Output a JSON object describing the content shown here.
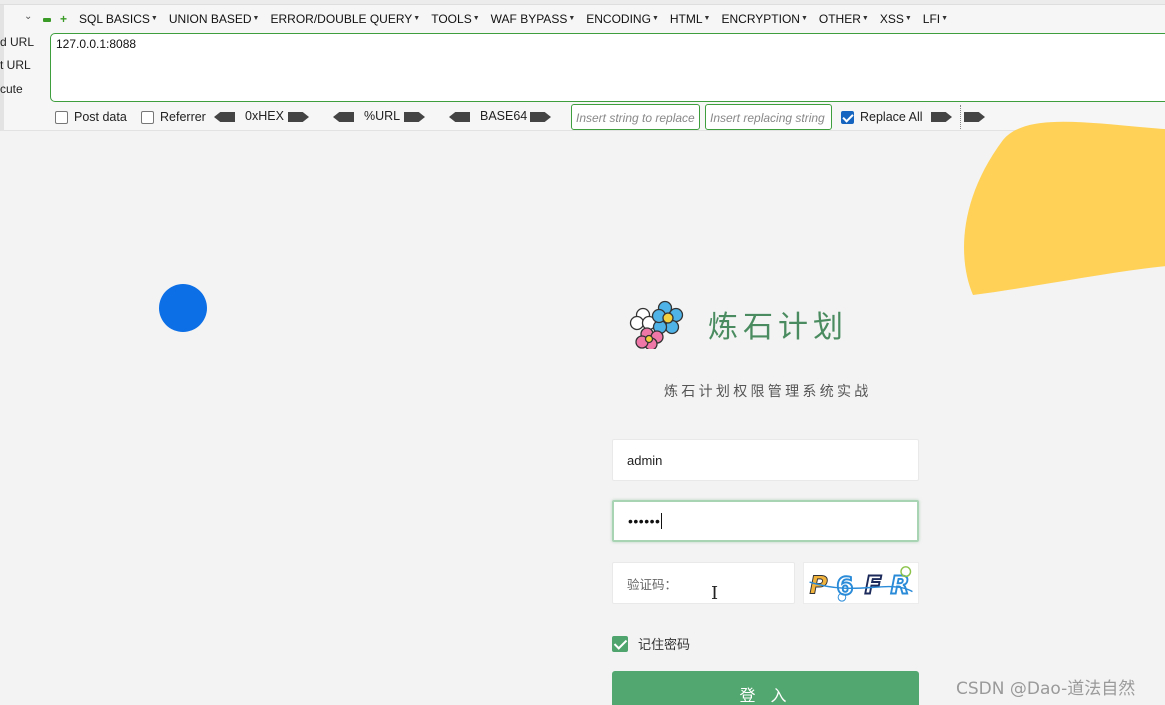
{
  "hackbar": {
    "menu": [
      "SQL BASICS",
      "UNION BASED",
      "ERROR/DOUBLE QUERY",
      "TOOLS",
      "WAF BYPASS",
      "ENCODING",
      "HTML",
      "ENCRYPTION",
      "OTHER",
      "XSS",
      "LFI"
    ],
    "side_labels": [
      "d URL",
      "t URL",
      "cute"
    ],
    "url_value": "127.0.0.1:8088",
    "post_data_label": "Post data",
    "referrer_label": "Referrer",
    "hex_label": "0xHEX",
    "url_enc_label": "%URL",
    "base64_label": "BASE64",
    "find_placeholder": "Insert string to replace",
    "replace_placeholder": "Insert replacing string",
    "replace_all_label": "Replace All",
    "replace_all_checked": true,
    "accent_color": "#3e9e3e"
  },
  "login": {
    "brand_title": "炼石计划",
    "subtitle": "炼石计划权限管理系统实战",
    "username": "admin",
    "password_mask": "••••••",
    "captcha_placeholder": "验证码：",
    "captcha_text": "P6FR",
    "remember_label": "记住密码",
    "remember_checked": true,
    "login_button": "登 入",
    "accent_color": "#52a66f"
  },
  "watermark": "CSDN @Dao-道法自然"
}
